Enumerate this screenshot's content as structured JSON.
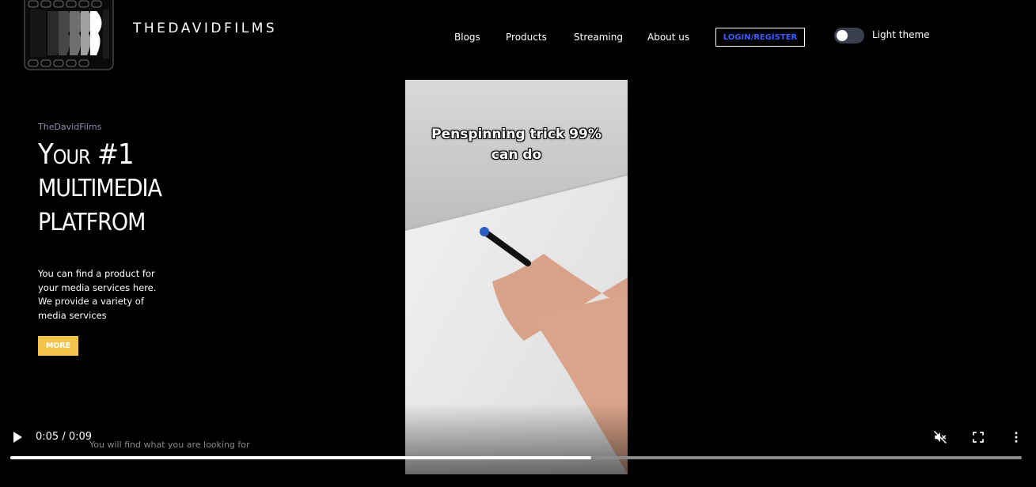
{
  "brand": {
    "name": "THEDAVIDFILMS"
  },
  "nav": {
    "items": [
      {
        "label": "Blogs"
      },
      {
        "label": "Products"
      },
      {
        "label": "Streaming"
      },
      {
        "label": "About us"
      }
    ],
    "login_label": "LOGIN/REGISTER",
    "theme_toggle_label": "Light theme",
    "theme_toggle_on": false
  },
  "hero": {
    "eyebrow": "TheDavidFilms",
    "headline_line1": "Your #1",
    "headline_line2": "MULTIMEDIA",
    "headline_line3": "PLATFROM",
    "description": "You can find a product for your media services here. We provide a variety of media services",
    "more_label": "MORE",
    "more_color": "#f2c44c"
  },
  "video": {
    "caption_line1": "Penspinning trick 99%",
    "caption_line2": "can do",
    "current_time": "0:05 / 0:09",
    "progress": 0.574,
    "subtitle": "You will find what you are looking for",
    "muted": true
  },
  "icons": {
    "play": "play-icon",
    "mute": "volume-muted-icon",
    "fullscreen": "fullscreen-icon",
    "more": "more-vert-icon"
  }
}
